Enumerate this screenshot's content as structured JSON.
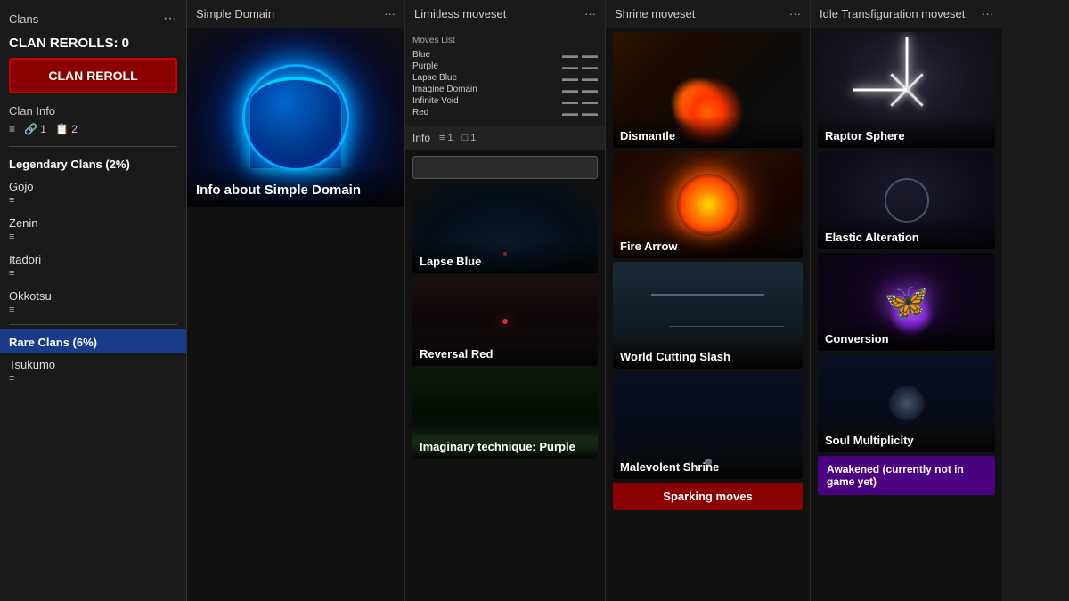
{
  "sidebar": {
    "title": "Clans",
    "rerolls_label": "CLAN REROLLS: 0",
    "reroll_btn": "CLAN REROLL",
    "clan_info": "Clan Info",
    "icons": [
      "≡",
      "🔗 1",
      "📋 2"
    ],
    "legendary_section": "Legendary Clans (2%)",
    "legendary_clans": [
      {
        "name": "Gojo",
        "icon": "≡"
      },
      {
        "name": "Zenin",
        "icon": "≡"
      },
      {
        "name": "Itadori",
        "icon": "≡"
      },
      {
        "name": "Okkotsu",
        "icon": "≡"
      }
    ],
    "rare_section": "Rare Clans (6%)",
    "rare_clans": [
      {
        "name": "Tsukumo",
        "icon": "≡"
      }
    ]
  },
  "columns": {
    "simple_domain": {
      "title": "Simple Domain",
      "card_label": "Info about Simple Domain"
    },
    "limitless": {
      "title": "Limitless moveset",
      "moves_list_title": "Moves List",
      "moves": [
        {
          "name": "Blue",
          "v1": "",
          "v2": ""
        },
        {
          "name": "Purple",
          "v1": "",
          "v2": ""
        },
        {
          "name": "Lapse Blue",
          "v1": "",
          "v2": ""
        },
        {
          "name": "Imagine Domain",
          "v1": "",
          "v2": ""
        },
        {
          "name": "Infinite Void",
          "v1": "",
          "v2": ""
        },
        {
          "name": "Red",
          "v1": "",
          "v2": ""
        }
      ],
      "info_label": "Info",
      "info_attach": "1",
      "info_img": "1",
      "search_placeholder": "",
      "move_cards": [
        {
          "label": "Lapse Blue"
        },
        {
          "label": "Reversal Red"
        },
        {
          "label": "Imaginary technique: Purple"
        }
      ]
    },
    "shrine": {
      "title": "Shrine moveset",
      "move_cards": [
        {
          "label": "Dismantle"
        },
        {
          "label": "Fire Arrow"
        },
        {
          "label": "World Cutting Slash"
        },
        {
          "label": "Malevolent Shrine"
        }
      ],
      "sparking_label": "Sparking moves"
    },
    "idle": {
      "title": "Idle Transfiguration moveset",
      "move_cards": [
        {
          "label": "Raptor Sphere"
        },
        {
          "label": "Elastic Alteration"
        },
        {
          "label": "Conversion"
        },
        {
          "label": "Soul Multiplicity"
        }
      ],
      "awakened_label": "Awakened (currently not in game yet)"
    }
  }
}
